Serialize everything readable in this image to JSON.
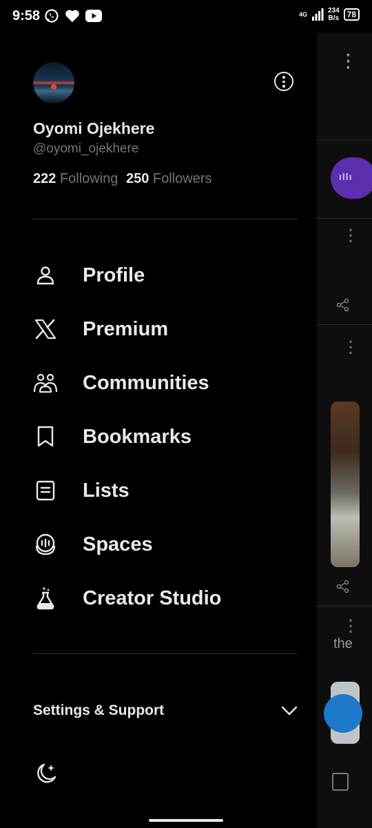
{
  "status_bar": {
    "time": "9:58",
    "network_label": "4G",
    "speed_value": "234",
    "speed_unit": "B/s",
    "battery": "78"
  },
  "profile": {
    "name": "Oyomi Ojekhere",
    "handle": "@oyomi_ojekhere",
    "following_count": "222",
    "following_label": "Following",
    "followers_count": "250",
    "followers_label": "Followers"
  },
  "menu": [
    {
      "label": "Profile",
      "icon": "person-icon"
    },
    {
      "label": "Premium",
      "icon": "x-logo-icon"
    },
    {
      "label": "Communities",
      "icon": "communities-icon"
    },
    {
      "label": "Bookmarks",
      "icon": "bookmark-icon"
    },
    {
      "label": "Lists",
      "icon": "lists-icon"
    },
    {
      "label": "Spaces",
      "icon": "spaces-icon"
    },
    {
      "label": "Creator Studio",
      "icon": "flask-icon"
    }
  ],
  "settings": {
    "label": "Settings & Support"
  },
  "background_feed": {
    "partial_text": "the"
  },
  "colors": {
    "background": "#000000",
    "text_primary": "#e7e9ea",
    "text_secondary": "#71767b",
    "divider": "#2f3336",
    "spaces_purple": "#5b2fb0"
  }
}
